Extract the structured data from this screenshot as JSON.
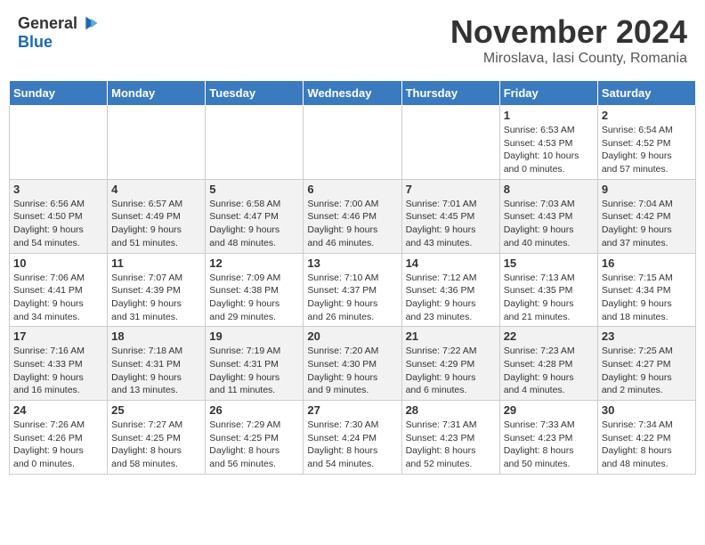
{
  "header": {
    "logo": {
      "general": "General",
      "blue": "Blue"
    },
    "title": "November 2024",
    "subtitle": "Miroslava, Iasi County, Romania"
  },
  "calendar": {
    "days_of_week": [
      "Sunday",
      "Monday",
      "Tuesday",
      "Wednesday",
      "Thursday",
      "Friday",
      "Saturday"
    ],
    "weeks": [
      [
        {
          "day": "",
          "content": ""
        },
        {
          "day": "",
          "content": ""
        },
        {
          "day": "",
          "content": ""
        },
        {
          "day": "",
          "content": ""
        },
        {
          "day": "",
          "content": ""
        },
        {
          "day": "1",
          "content": "Sunrise: 6:53 AM\nSunset: 4:53 PM\nDaylight: 10 hours\nand 0 minutes."
        },
        {
          "day": "2",
          "content": "Sunrise: 6:54 AM\nSunset: 4:52 PM\nDaylight: 9 hours\nand 57 minutes."
        }
      ],
      [
        {
          "day": "3",
          "content": "Sunrise: 6:56 AM\nSunset: 4:50 PM\nDaylight: 9 hours\nand 54 minutes."
        },
        {
          "day": "4",
          "content": "Sunrise: 6:57 AM\nSunset: 4:49 PM\nDaylight: 9 hours\nand 51 minutes."
        },
        {
          "day": "5",
          "content": "Sunrise: 6:58 AM\nSunset: 4:47 PM\nDaylight: 9 hours\nand 48 minutes."
        },
        {
          "day": "6",
          "content": "Sunrise: 7:00 AM\nSunset: 4:46 PM\nDaylight: 9 hours\nand 46 minutes."
        },
        {
          "day": "7",
          "content": "Sunrise: 7:01 AM\nSunset: 4:45 PM\nDaylight: 9 hours\nand 43 minutes."
        },
        {
          "day": "8",
          "content": "Sunrise: 7:03 AM\nSunset: 4:43 PM\nDaylight: 9 hours\nand 40 minutes."
        },
        {
          "day": "9",
          "content": "Sunrise: 7:04 AM\nSunset: 4:42 PM\nDaylight: 9 hours\nand 37 minutes."
        }
      ],
      [
        {
          "day": "10",
          "content": "Sunrise: 7:06 AM\nSunset: 4:41 PM\nDaylight: 9 hours\nand 34 minutes."
        },
        {
          "day": "11",
          "content": "Sunrise: 7:07 AM\nSunset: 4:39 PM\nDaylight: 9 hours\nand 31 minutes."
        },
        {
          "day": "12",
          "content": "Sunrise: 7:09 AM\nSunset: 4:38 PM\nDaylight: 9 hours\nand 29 minutes."
        },
        {
          "day": "13",
          "content": "Sunrise: 7:10 AM\nSunset: 4:37 PM\nDaylight: 9 hours\nand 26 minutes."
        },
        {
          "day": "14",
          "content": "Sunrise: 7:12 AM\nSunset: 4:36 PM\nDaylight: 9 hours\nand 23 minutes."
        },
        {
          "day": "15",
          "content": "Sunrise: 7:13 AM\nSunset: 4:35 PM\nDaylight: 9 hours\nand 21 minutes."
        },
        {
          "day": "16",
          "content": "Sunrise: 7:15 AM\nSunset: 4:34 PM\nDaylight: 9 hours\nand 18 minutes."
        }
      ],
      [
        {
          "day": "17",
          "content": "Sunrise: 7:16 AM\nSunset: 4:33 PM\nDaylight: 9 hours\nand 16 minutes."
        },
        {
          "day": "18",
          "content": "Sunrise: 7:18 AM\nSunset: 4:31 PM\nDaylight: 9 hours\nand 13 minutes."
        },
        {
          "day": "19",
          "content": "Sunrise: 7:19 AM\nSunset: 4:31 PM\nDaylight: 9 hours\nand 11 minutes."
        },
        {
          "day": "20",
          "content": "Sunrise: 7:20 AM\nSunset: 4:30 PM\nDaylight: 9 hours\nand 9 minutes."
        },
        {
          "day": "21",
          "content": "Sunrise: 7:22 AM\nSunset: 4:29 PM\nDaylight: 9 hours\nand 6 minutes."
        },
        {
          "day": "22",
          "content": "Sunrise: 7:23 AM\nSunset: 4:28 PM\nDaylight: 9 hours\nand 4 minutes."
        },
        {
          "day": "23",
          "content": "Sunrise: 7:25 AM\nSunset: 4:27 PM\nDaylight: 9 hours\nand 2 minutes."
        }
      ],
      [
        {
          "day": "24",
          "content": "Sunrise: 7:26 AM\nSunset: 4:26 PM\nDaylight: 9 hours\nand 0 minutes."
        },
        {
          "day": "25",
          "content": "Sunrise: 7:27 AM\nSunset: 4:25 PM\nDaylight: 8 hours\nand 58 minutes."
        },
        {
          "day": "26",
          "content": "Sunrise: 7:29 AM\nSunset: 4:25 PM\nDaylight: 8 hours\nand 56 minutes."
        },
        {
          "day": "27",
          "content": "Sunrise: 7:30 AM\nSunset: 4:24 PM\nDaylight: 8 hours\nand 54 minutes."
        },
        {
          "day": "28",
          "content": "Sunrise: 7:31 AM\nSunset: 4:23 PM\nDaylight: 8 hours\nand 52 minutes."
        },
        {
          "day": "29",
          "content": "Sunrise: 7:33 AM\nSunset: 4:23 PM\nDaylight: 8 hours\nand 50 minutes."
        },
        {
          "day": "30",
          "content": "Sunrise: 7:34 AM\nSunset: 4:22 PM\nDaylight: 8 hours\nand 48 minutes."
        }
      ]
    ]
  }
}
